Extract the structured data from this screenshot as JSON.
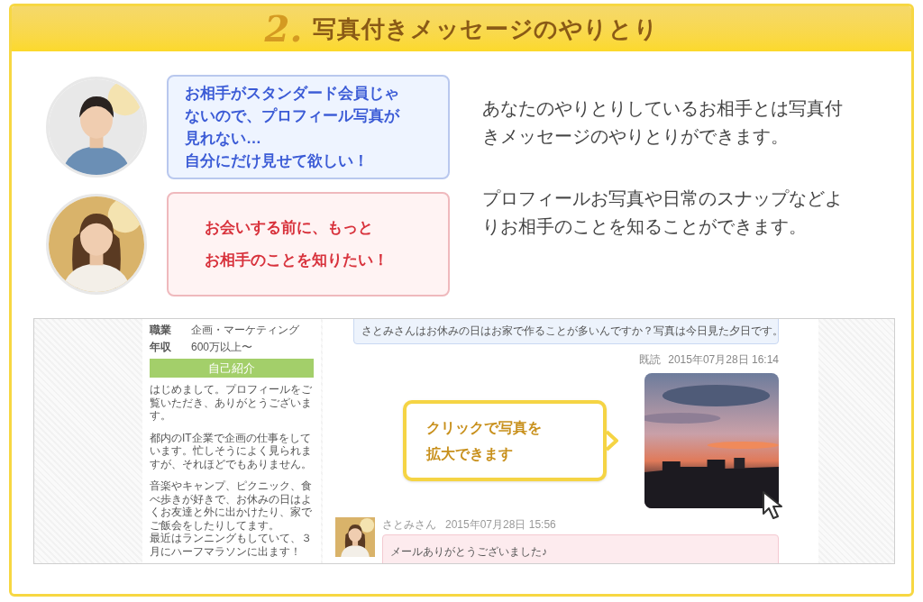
{
  "header": {
    "number": "2.",
    "title": "写真付きメッセージのやりとり"
  },
  "dialogues": [
    {
      "kind": "male",
      "color": "#3b5bd6",
      "lines": [
        "お相手がスタンダード会員じゃないので、プロフィール写真が見れない…",
        "自分にだけ見せて欲しい！"
      ]
    },
    {
      "kind": "female",
      "color": "#d8323c",
      "lines": [
        "お会いする前に、もっと",
        "お相手のことを知りたい！"
      ]
    }
  ],
  "descriptions": [
    "あなたのやりとりしているお相手とは写真付きメッセージのやりとりができます。",
    "プロフィールお写真や日常のスナップなどよりお相手のことを知ることができます。"
  ],
  "screenshot": {
    "profile": [
      {
        "label": "職業",
        "value": "企画・マーケティング"
      },
      {
        "label": "年収",
        "value": "600万以上〜"
      }
    ],
    "section_title": "自己紹介",
    "intro": [
      {
        "kind": "paragraph",
        "text": "はじめまして。プロフィールをご覧いただき、ありがとうございます。"
      },
      {
        "kind": "paragraph",
        "text": "都内のIT企業で企画の仕事をしています。忙しそうによく見られますが、それほどでもありません。"
      },
      {
        "kind": "paragraph",
        "text": "音楽やキャンプ、ピクニック、食べ歩きが好きで、お休みの日はよくお友達と外に出かけたり、家でご飯会をしたりしてます。"
      },
      {
        "kind": "line",
        "text": "最近はランニングもしていて、３月にハーフマラソンに出ます！"
      }
    ],
    "messages": [
      {
        "kind": "sent_text",
        "text": "さとみさんはお休みの日はお家で作ることが多いんですか？写真は今日見た夕日です。"
      },
      {
        "kind": "sent_photo",
        "read": "既読",
        "time": "2015年07月28日 16:14",
        "callout": "クリックで写真を拡大できます"
      },
      {
        "kind": "received",
        "name": "さとみさん",
        "time": "2015年07月28日 15:56",
        "text": "メールありがとうございました♪"
      }
    ]
  }
}
